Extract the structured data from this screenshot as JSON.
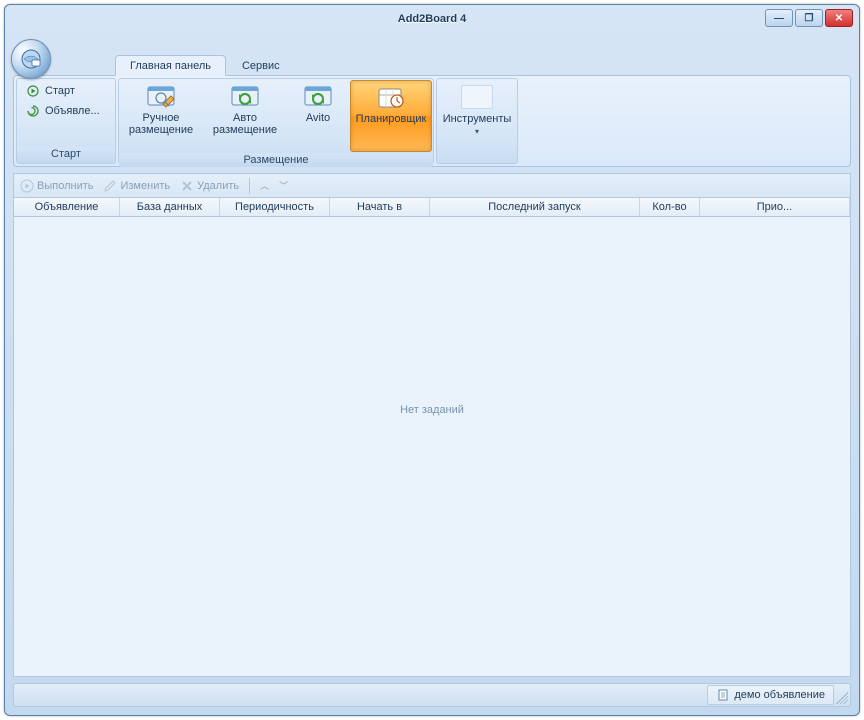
{
  "window": {
    "title": "Add2Board 4"
  },
  "tabs": {
    "main": "Главная панель",
    "service": "Сервис"
  },
  "ribbon": {
    "groups": {
      "start": {
        "label": "Старт",
        "items": {
          "start": "Старт",
          "ads": "Объявле..."
        }
      },
      "placement": {
        "label": "Размещение",
        "buttons": {
          "manual": "Ручное\nразмещение",
          "auto": "Авто\nразмещение",
          "avito": "Avito",
          "scheduler": "Планировщик"
        }
      },
      "tools": {
        "label": "Инструменты"
      }
    }
  },
  "toolbar": {
    "execute": "Выполнить",
    "edit": "Изменить",
    "delete": "Удалить"
  },
  "grid": {
    "columns": {
      "ad": "Объявление",
      "db": "База данных",
      "period": "Периодичность",
      "startAt": "Начать в",
      "lastRun": "Последний запуск",
      "count": "Кол-во",
      "prio": "Прио..."
    },
    "emptyText": "Нет заданий"
  },
  "status": {
    "demo": "демо объявление"
  }
}
